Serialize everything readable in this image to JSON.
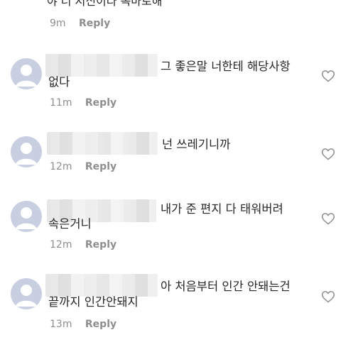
{
  "top": {
    "partial_text": "야 너  저신이다  속마로해",
    "time": "9m",
    "reply": "Reply"
  },
  "comments": [
    {
      "text_line1": "그  좋은말 너한테 해당사항",
      "text_line2": "없다",
      "time": "11m",
      "reply": "Reply"
    },
    {
      "text_line1": "넌  쓰레기니까",
      "text_line2": "",
      "time": "12m",
      "reply": "Reply"
    },
    {
      "text_line1": "내가  준 편지  다 태워버려",
      "text_line2": "속은거니",
      "time": "12m",
      "reply": "Reply"
    },
    {
      "text_line1": "아 처음부터 인간  안돼는건",
      "text_line2": "끝까지  인간안돼지",
      "time": "13m",
      "reply": "Reply"
    }
  ],
  "icons": {
    "avatar": "default-avatar-icon",
    "like": "heart-icon"
  },
  "colors": {
    "avatar_bg": "#c7cfe0",
    "meta_text": "#8e8e8e",
    "body_text": "#262626"
  }
}
